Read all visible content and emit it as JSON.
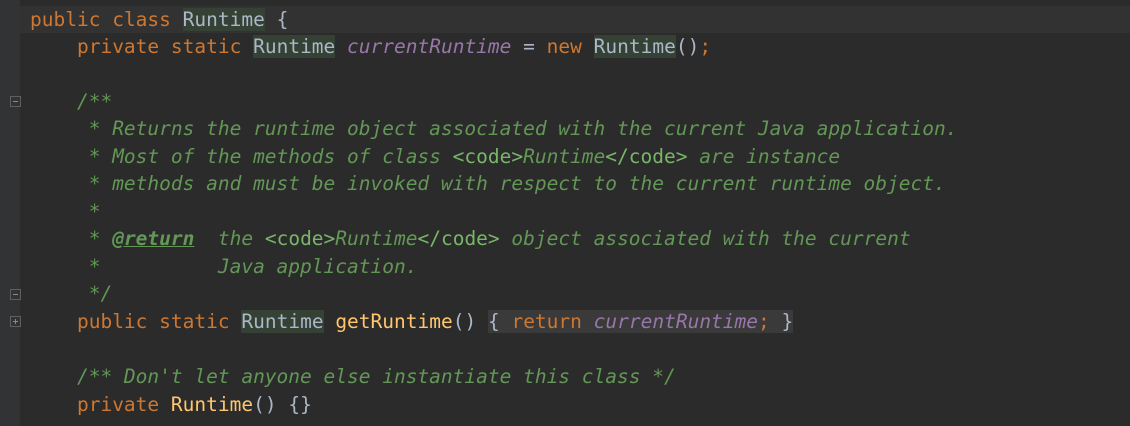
{
  "code": {
    "line1": {
      "kw_public": "public",
      "kw_class": "class",
      "class_name": "Runtime",
      "brace": "{"
    },
    "line2": {
      "kw_private": "private",
      "kw_static": "static",
      "type": "Runtime",
      "field": "currentRuntime",
      "op": " = ",
      "kw_new": "new",
      "ctor": "Runtime",
      "parens": "()",
      "semi": ";"
    },
    "doc1": {
      "open": "/**",
      "l1": " * Returns the runtime object associated with the current Java application.",
      "l2_a": " * Most of the methods of class ",
      "l2_code_open": "<code>",
      "l2_b": "Runtime",
      "l2_code_close": "</code>",
      "l2_c": " are instance",
      "l3": " * methods and must be invoked with respect to the current runtime object.",
      "l4": " *",
      "l5_a": " * ",
      "l5_tag": "@return",
      "l5_b": "  the ",
      "l5_code_open": "<code>",
      "l5_c": "Runtime",
      "l5_code_close": "</code>",
      "l5_d": " object associated with the current",
      "l6": " *          Java application.",
      "close": " */"
    },
    "method": {
      "kw_public": "public",
      "kw_static": "static",
      "type": "Runtime",
      "name": "getRuntime",
      "parens": "()",
      "open_brace": "{",
      "kw_return": "return",
      "field": "currentRuntime",
      "semi": ";",
      "close_brace": "}"
    },
    "doc2": {
      "text": "/** Don't let anyone else instantiate this class */"
    },
    "ctor": {
      "kw_private": "private",
      "name": "Runtime",
      "parens": "()",
      "body": "{}"
    }
  }
}
